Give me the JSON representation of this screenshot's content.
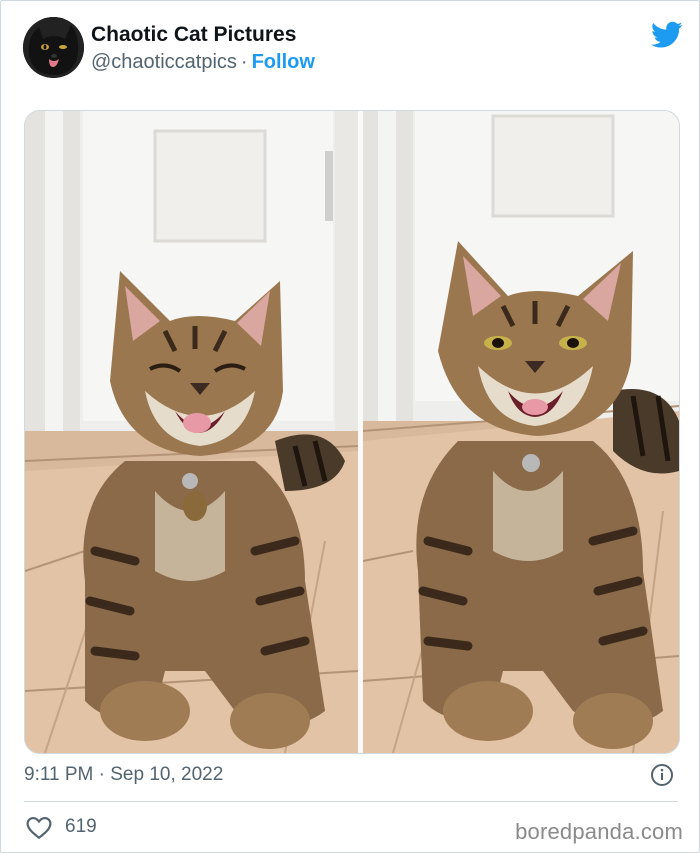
{
  "tweet": {
    "author_name": "Chaotic Cat Pictures",
    "handle": "@chaoticcatpics",
    "separator": "·",
    "follow_label": "Follow",
    "timestamp": "9:11 PM · Sep 10, 2022",
    "like_count": "619"
  },
  "icons": {
    "platform": "twitter-bird-icon",
    "info": "info-icon",
    "like": "heart-icon"
  },
  "colors": {
    "accent": "#1d9bf0",
    "text_primary": "#0f1419",
    "text_secondary": "#536471",
    "border": "#cfd9de"
  },
  "watermark": "boredpanda.com"
}
